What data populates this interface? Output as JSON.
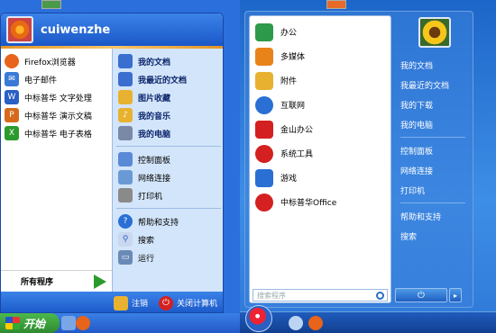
{
  "xp": {
    "username": "cuiwenzhe",
    "left_items": [
      {
        "label": "Firefox浏览器",
        "icon": "firefox-icon",
        "color": "#e8641a"
      },
      {
        "label": "电子邮件",
        "icon": "mail-icon",
        "color": "#3a7ad6"
      },
      {
        "label": "中标普华 文字处理",
        "icon": "writer-icon",
        "color": "#2a5fc4"
      },
      {
        "label": "中标普华 演示文稿",
        "icon": "impress-icon",
        "color": "#d66a1a"
      },
      {
        "label": "中标普华 电子表格",
        "icon": "calc-icon",
        "color": "#2c9a2c"
      }
    ],
    "all_programs": "所有程序",
    "right_bold": [
      "我的文档",
      "我最近的文档",
      "图片收藏",
      "我的音乐",
      "我的电脑"
    ],
    "right_group2": [
      "控制面板",
      "网络连接",
      "打印机"
    ],
    "right_group3": [
      "帮助和支持",
      "搜索",
      "运行"
    ],
    "logoff": "注销",
    "shutdown": "关闭计算机",
    "start_label": "开始"
  },
  "w7": {
    "left_items": [
      {
        "label": "办公",
        "icon": "office-icon",
        "color": "#2c9a4a"
      },
      {
        "label": "多媒体",
        "icon": "multimedia-icon",
        "color": "#e8831a"
      },
      {
        "label": "附件",
        "icon": "folder-icon",
        "color": "#e8b230"
      },
      {
        "label": "互联网",
        "icon": "globe-icon",
        "color": "#2a6fd4"
      },
      {
        "label": "金山办公",
        "icon": "kingsoft-icon",
        "color": "#d42020"
      },
      {
        "label": "系统工具",
        "icon": "tools-icon",
        "color": "#d42020"
      },
      {
        "label": "游戏",
        "icon": "gamepad-icon",
        "color": "#2a6fd4"
      },
      {
        "label": "中标普华Office",
        "icon": "cs2c-icon",
        "color": "#d42020"
      }
    ],
    "search_placeholder": "搜索程序",
    "right_group1": [
      "我的文档",
      "我最近的文档",
      "我的下载",
      "我的电脑"
    ],
    "right_group2": [
      "控制面板",
      "网络连接",
      "打印机"
    ],
    "right_group3": [
      "帮助和支持",
      "搜索"
    ]
  }
}
